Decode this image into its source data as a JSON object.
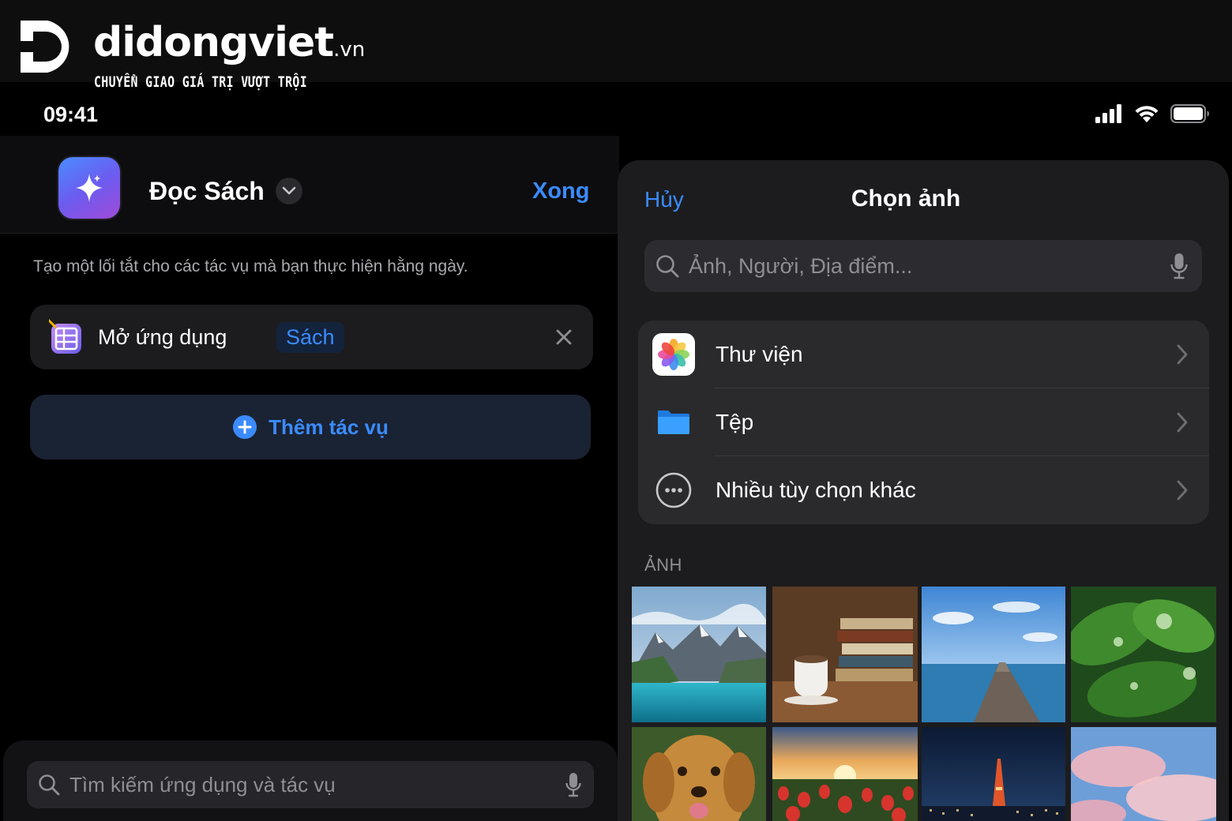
{
  "watermark": {
    "name": "didongviet",
    "tld": ".vn",
    "tagline": "CHUYỂN GIAO GIÁ TRỊ VƯỢT TRỘI"
  },
  "status_bar": {
    "time": "09:41",
    "icons": [
      "cellular-signal-icon",
      "wifi-icon",
      "battery-icon"
    ]
  },
  "editor": {
    "app_icon": "sparkle-icon",
    "title": "Đọc Sách",
    "done_label": "Xong",
    "description": "Tạo một lối tắt cho các tác vụ mà bạn thực hiện hằng ngày.",
    "action": {
      "label": "Mở ứng dụng",
      "token": "Sách"
    },
    "add_action_label": "Thêm tác vụ",
    "search_placeholder": "Tìm kiếm ứng dụng và tác vụ"
  },
  "picker": {
    "cancel_label": "Hủy",
    "title": "Chọn ảnh",
    "search_placeholder": "Ảnh, Người, Địa điểm...",
    "sources": [
      {
        "label": "Thư viện",
        "icon": "photos-icon"
      },
      {
        "label": "Tệp",
        "icon": "folder-icon"
      },
      {
        "label": "Nhiều tùy chọn khác",
        "icon": "more-options-icon"
      }
    ],
    "section_title": "ẢNH",
    "photos": [
      "mountain-lake-photo",
      "books-coffee-photo",
      "pier-sea-photo",
      "wet-leaves-photo",
      "golden-retriever-photo",
      "tulip-sunset-photo",
      "city-tower-night-photo",
      "pink-clouds-photo"
    ]
  },
  "colors": {
    "accent": "#3b8bff",
    "sheet_background": "#1c1c1e",
    "group_background": "#2a2a2d"
  }
}
